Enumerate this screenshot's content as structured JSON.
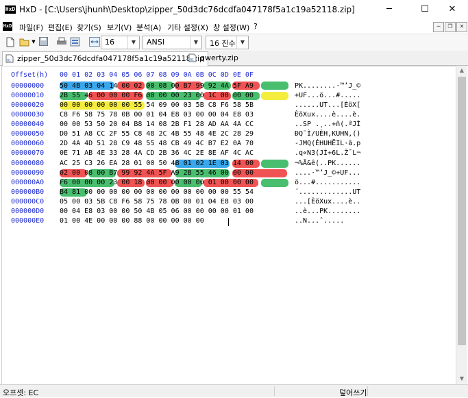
{
  "window": {
    "app_icon": "HxD",
    "title": "HxD - [C:\\Users\\jhunh\\Desktop\\zipper_50d3dc76dcdfa047178f5a1c19a52118.zip]",
    "minimize_icon": "─",
    "maximize_icon": "☐",
    "close_icon": "✕"
  },
  "menu": {
    "items": [
      "파일(F)",
      "편집(E)",
      "찾기(S)",
      "보기(V)",
      "분석(A)",
      "기타 설정(X)",
      "창 설정(W)",
      "?"
    ],
    "mdi": [
      "─",
      "❐",
      "✕"
    ]
  },
  "toolbar": {
    "bytes_per_row": "16",
    "charset": "ANSI",
    "offset_base": "16 진수"
  },
  "tabs": [
    {
      "label": "zipper_50d3dc76dcdfa047178f5a1c19a52118.zip",
      "active": true
    },
    {
      "label": "qwerty.zip",
      "active": false
    }
  ],
  "editor": {
    "header_offset": "Offset(h)",
    "header_columns": "00 01 02 03 04 05 06 07 08 09 0A 0B 0C 0D 0E 0F",
    "rows": [
      {
        "offset": "00000000",
        "hex": "50 4B 03 04 14 00 02 00 08 00 B7 99 92 4A 5F A9",
        "text": "PK........·™’J_©"
      },
      {
        "offset": "00000010",
        "hex": "2B 55 46 00 00 00 F6 00 00 00 23 00 1C 00 00 00",
        "text": "+UF...ö...#....."
      },
      {
        "offset": "00000020",
        "hex": "00 00 00 00 00 00 55 54 09 00 03 5B C8 F6 58 5B",
        "text": "......UT...[ÈöX["
      },
      {
        "offset": "00000030",
        "hex": "C8 F6 58 75 78 0B 00 01 04 E8 03 00 00 04 E8 03",
        "text": "ÈöXux....è....è."
      },
      {
        "offset": "00000040",
        "hex": "00 00 53 50 20 04 B8 14 08 2B F1 28 AD AA 4A CC",
        "text": "..SP .¸..+ñ(.ªJÌ"
      },
      {
        "offset": "00000050",
        "hex": "D0 51 A8 CC 2F 55 C8 48 2C 4B 55 48 4E 2C 28 29",
        "text": "ÐQ¨Ì/UÈH,KUHN,()"
      },
      {
        "offset": "00000060",
        "hex": "2D 4A 4D 51 28 C9 48 55 48 CB 49 4C B7 E2 0A 70",
        "text": "-JMQ(ÉHUHËIL·â.p"
      },
      {
        "offset": "00000070",
        "hex": "0E 71 AB 4E 33 28 4A CD 2B 36 4C 2E 8E AF 4C AC",
        "text": ".q«N3(JÍ+6L.Ž¯L¬"
      },
      {
        "offset": "00000080",
        "hex": "AC 25 C3 26 EA 28 01 00 50 4B 01 02 1E 03 14 00",
        "text": "¬%Ã&ê(..PK......"
      },
      {
        "offset": "00000090",
        "hex": "02 00 08 00 B7 99 92 4A 5F A9 2B 55 46 00 00 00",
        "text": "....·™’J_©+UF..."
      },
      {
        "offset": "000000A0",
        "hex": "F6 00 00 00 23 00 18 00 00 00 00 00 01 00 00 00",
        "text": "ö...#..........."
      },
      {
        "offset": "000000B0",
        "hex": "B4 81 00 00 00 00 00 00 00 00 00 00 00 00 55 54",
        "text": "´.............UT"
      },
      {
        "offset": "000000C0",
        "hex": "05 00 03 5B C8 F6 58 75 78 0B 00 01 04 E8 03 00",
        "text": "...[ÈöXux....è.."
      },
      {
        "offset": "000000D0",
        "hex": "00 04 E8 03 00 00 50 4B 05 06 00 00 00 00 01 00",
        "text": "..è...PK........"
      },
      {
        "offset": "000000E0",
        "hex": "01 00 4E 00 00 00 88 00 00 00 00 00",
        "text": "..N...ˆ....."
      }
    ]
  },
  "status": {
    "offset": "오프셋: EC",
    "mode": "덮어쓰기"
  },
  "colors": {
    "offset_blue": "#1f2bd1",
    "hl_blue": "#1e9be8",
    "hl_red": "#ee3b3b",
    "hl_green": "#2fb55a",
    "hl_yellow": "#f4ea22"
  }
}
